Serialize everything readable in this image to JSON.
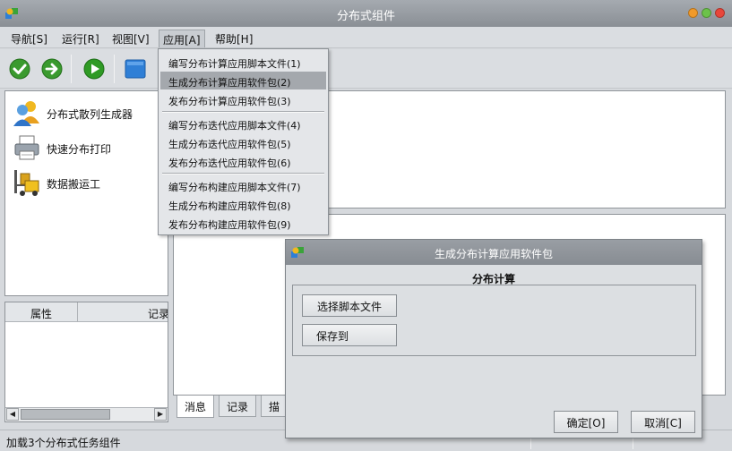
{
  "window": {
    "title": "分布式组件"
  },
  "menubar": [
    {
      "label": "导航[S]"
    },
    {
      "label": "运行[R]"
    },
    {
      "label": "视图[V]"
    },
    {
      "label": "应用[A]"
    },
    {
      "label": "帮助[H]"
    }
  ],
  "toolbar": {
    "icons": [
      "check-icon",
      "forward-icon",
      "run-icon",
      "window-icon"
    ],
    "colors": {
      "check": "#3a9a2e",
      "forward": "#3a9a2e",
      "run": "#2f9a25",
      "window": "#2f7fd6"
    }
  },
  "nav": [
    {
      "label": "分布式散列生成器",
      "icon": "users-icon"
    },
    {
      "label": "快速分布打印",
      "icon": "printer-icon"
    },
    {
      "label": "数据搬运工",
      "icon": "forklift-icon"
    }
  ],
  "props_table": {
    "columns": [
      "属性",
      "记录"
    ]
  },
  "tabs": [
    {
      "label": "消息"
    },
    {
      "label": "记录"
    },
    {
      "label": "描述"
    }
  ],
  "status": {
    "text": "加载3个分布式任务组件"
  },
  "dropdown": {
    "groups": [
      [
        "编写分布计算应用脚本文件(1)",
        "生成分布计算应用软件包(2)",
        "发布分布计算应用软件包(3)"
      ],
      [
        "编写分布迭代应用脚本文件(4)",
        "生成分布迭代应用软件包(5)",
        "发布分布迭代应用软件包(6)"
      ],
      [
        "编写分布构建应用脚本文件(7)",
        "生成分布构建应用软件包(8)",
        "发布分布构建应用软件包(9)"
      ]
    ],
    "selected": "生成分布计算应用软件包(2)"
  },
  "dialog": {
    "title": "生成分布计算应用软件包",
    "section": "分布计算",
    "select_script": "选择脚本文件",
    "save_to": "保存到",
    "ok": "确定[O]",
    "cancel": "取消[C]"
  }
}
